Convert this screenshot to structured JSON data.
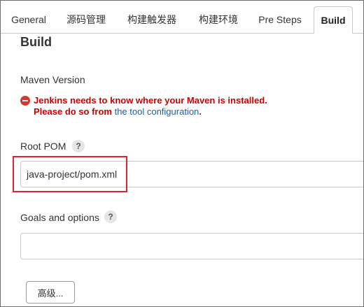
{
  "tabs": [
    {
      "label": "General",
      "active": false
    },
    {
      "label": "源码管理",
      "active": false
    },
    {
      "label": "构建触发器",
      "active": false
    },
    {
      "label": "构建环境",
      "active": false
    },
    {
      "label": "Pre Steps",
      "active": false
    },
    {
      "label": "Build",
      "active": true
    }
  ],
  "section": {
    "title": "Build"
  },
  "maven": {
    "label": "Maven Version",
    "error_line1": "Jenkins needs to know where your Maven is installed.",
    "error_line2_prefix": "Please do so from ",
    "error_link": "the tool configuration",
    "error_line2_suffix": "."
  },
  "root_pom": {
    "label": "Root POM",
    "help": "?",
    "value": "java-project/pom.xml"
  },
  "goals": {
    "label": "Goals and options",
    "help": "?",
    "value": ""
  },
  "advanced_button": "高级...",
  "colors": {
    "error": "#cc0000",
    "link": "#1a5ea8",
    "highlight": "#e0232e"
  }
}
